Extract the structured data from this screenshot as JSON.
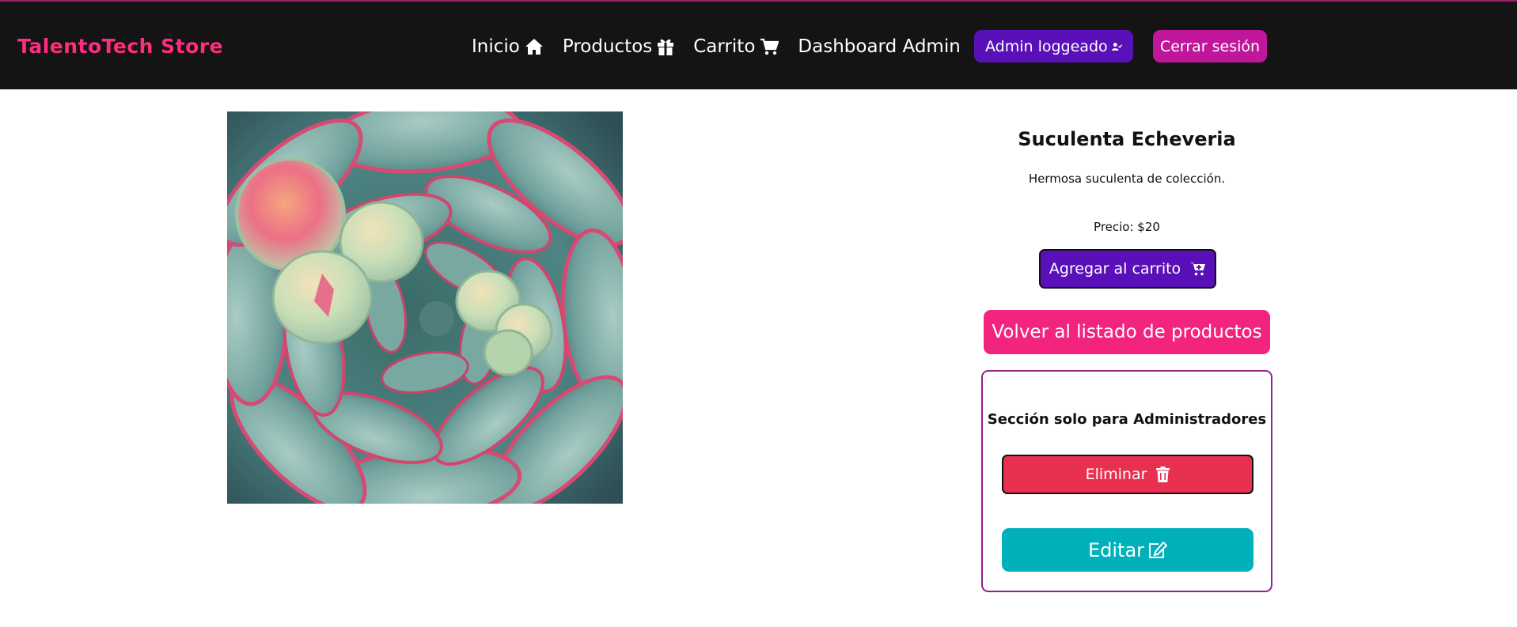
{
  "navbar": {
    "brand": "TalentoTech Store",
    "links": [
      {
        "label": "Inicio",
        "icon": "home-icon"
      },
      {
        "label": "Productos",
        "icon": "gift-icon"
      },
      {
        "label": "Carrito",
        "icon": "cart-icon"
      },
      {
        "label": "Dashboard Admin"
      }
    ],
    "admin_badge": {
      "label": "Admin loggeado",
      "icon": "user-check-icon"
    },
    "logout_label": "Cerrar sesión"
  },
  "product": {
    "image_alt": "Suculenta Echeveria",
    "title": "Suculenta Echeveria",
    "description": "Hermosa suculenta de colección.",
    "price_text": "Precio: $20",
    "add_to_cart_label": "Agregar al carrito",
    "back_label": "Volver al listado de productos"
  },
  "admin_section": {
    "title": "Sección solo para Administradores",
    "delete_label": "Eliminar",
    "edit_label": "Editar"
  },
  "colors": {
    "navbar_bg": "#141414",
    "brand": "#ff2d7e",
    "purple": "#5a10b8",
    "magenta": "#c0169b",
    "pink": "#f2247d",
    "red": "#e83150",
    "teal": "#00b0bb",
    "admin_border": "#96208f"
  }
}
